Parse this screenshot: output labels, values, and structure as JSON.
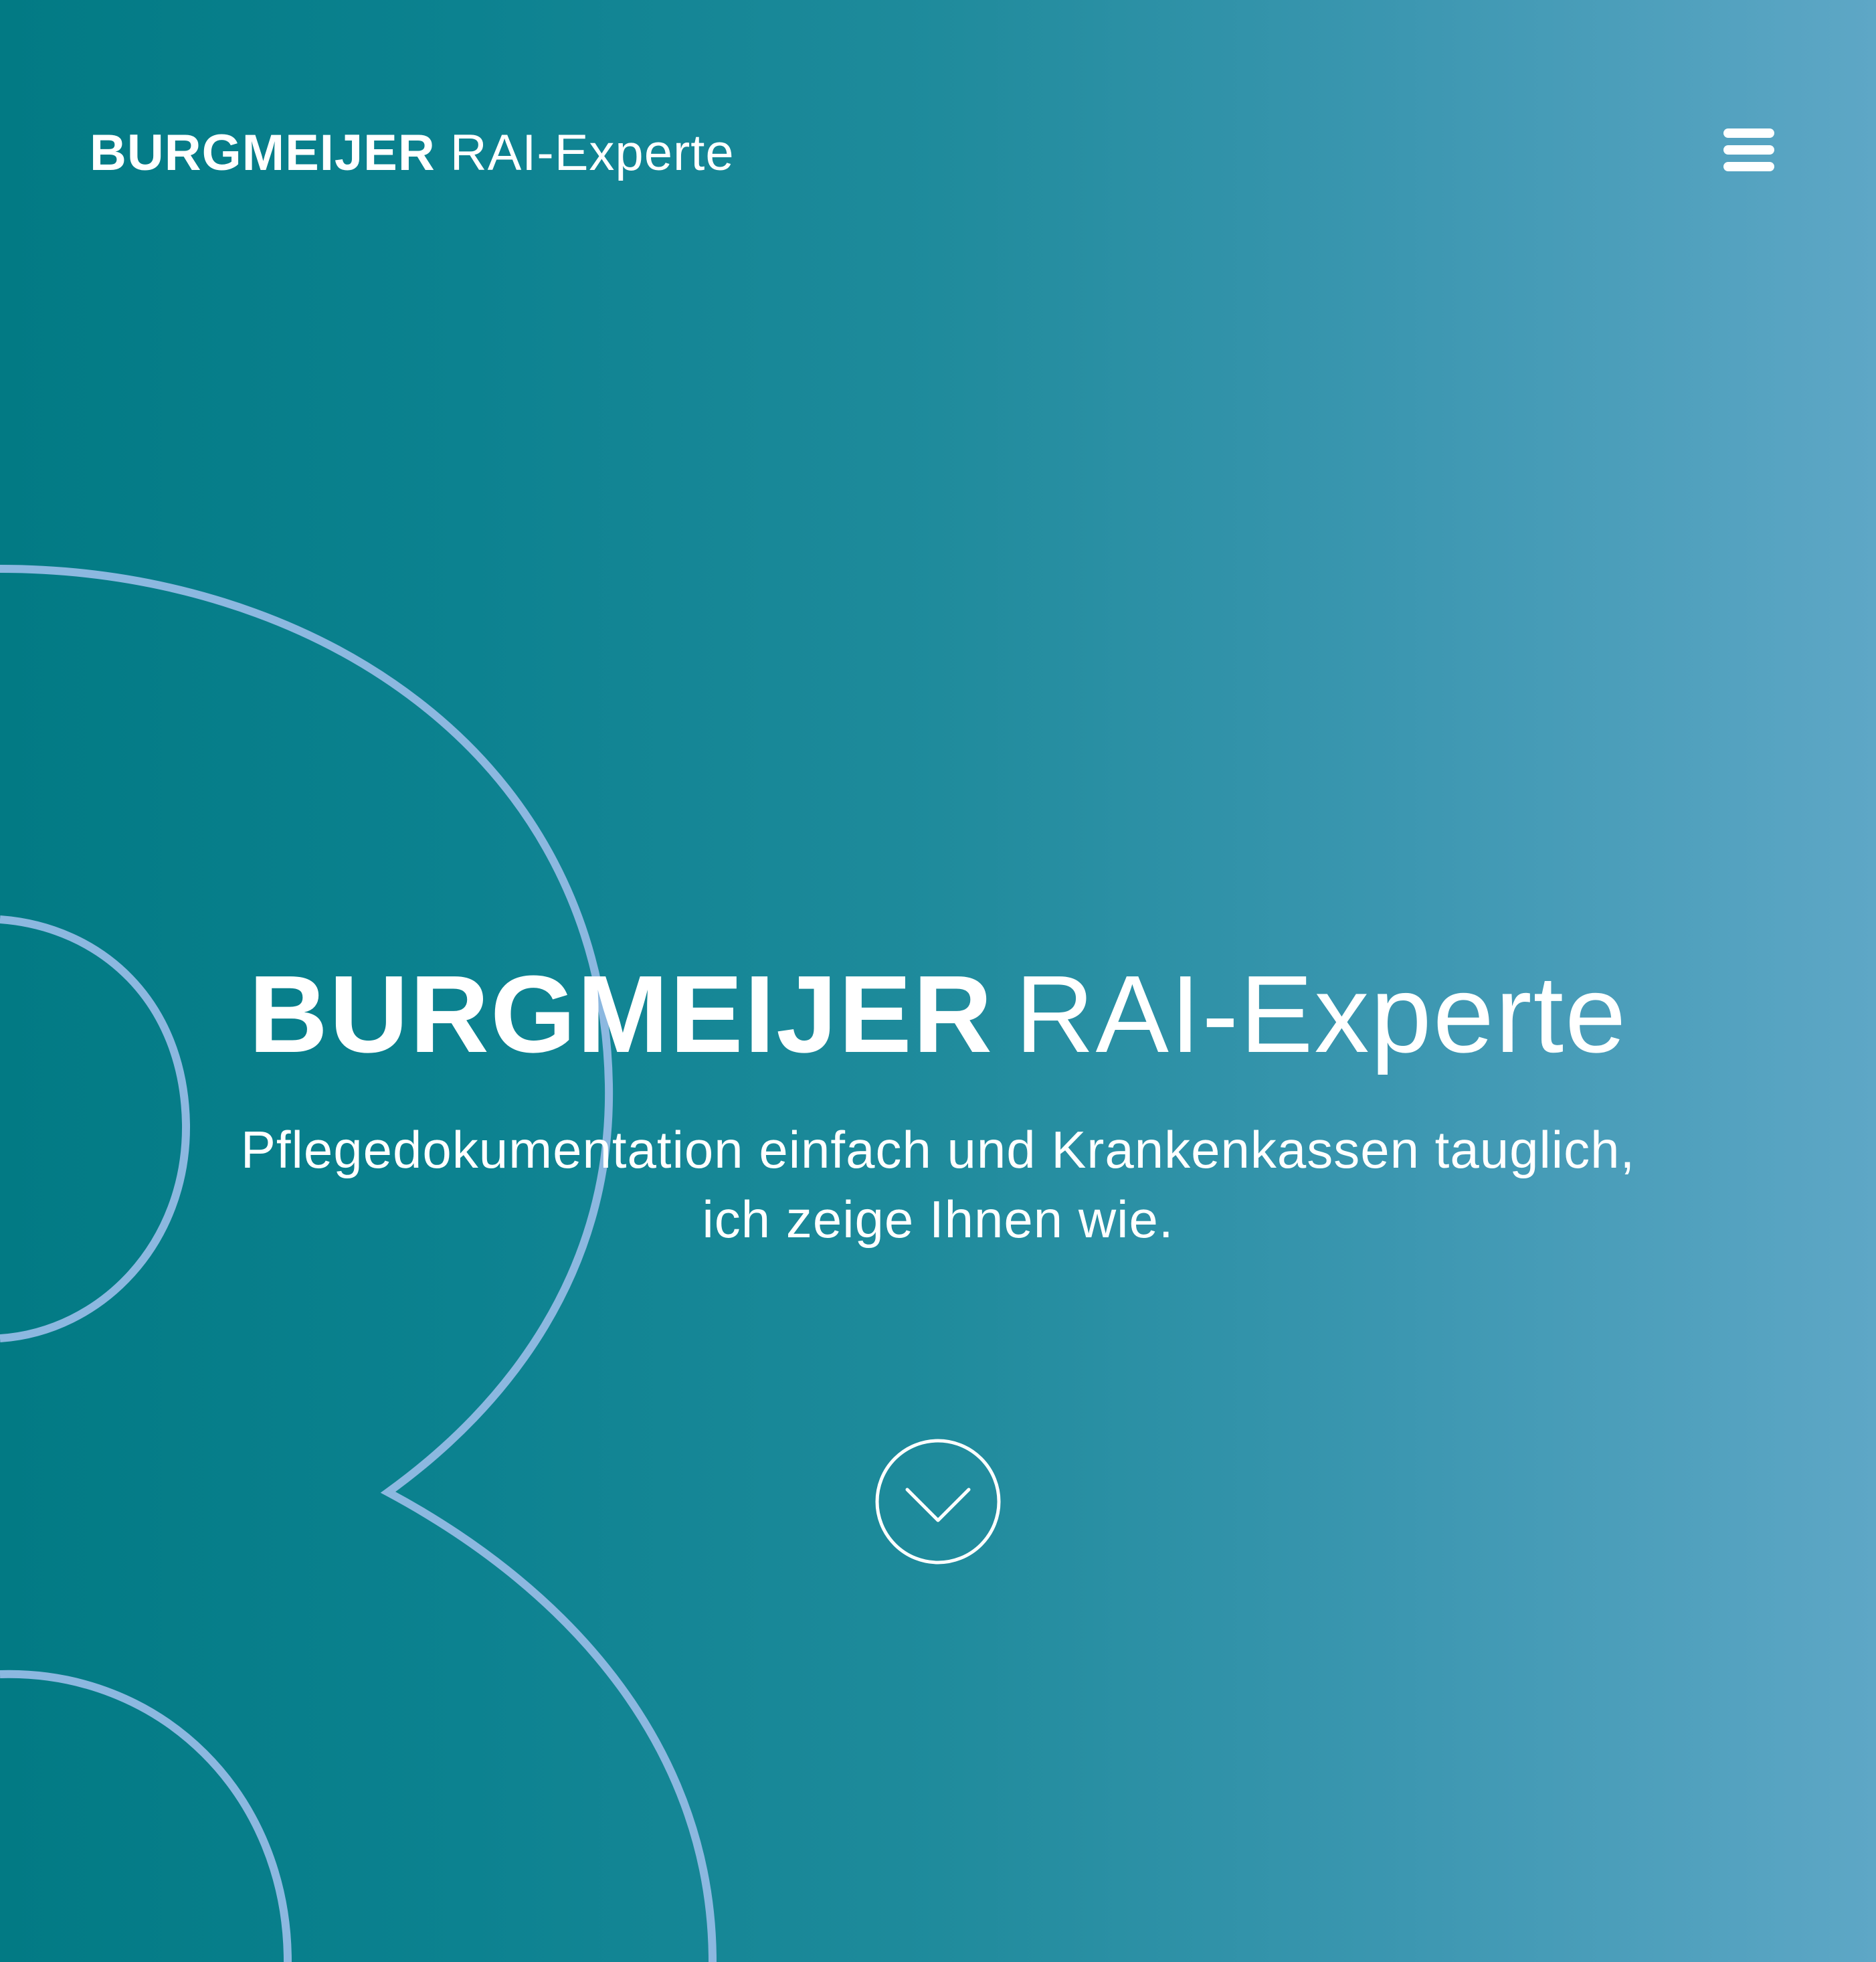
{
  "header": {
    "logo_bold": "BURGMEIJER",
    "logo_light": "RAI-Experte",
    "menu_icon": "hamburger-menu-icon"
  },
  "hero": {
    "title_bold": "BURGMEIJER",
    "title_light": "RAI-Experte",
    "subtitle_line1": "Pflegedokumentation einfach und Krankenkassen tauglich,",
    "subtitle_line2": "ich zeige Ihnen wie.",
    "scroll_icon": "chevron-down-circle-icon"
  },
  "colors": {
    "gradient_start": "#027a84",
    "gradient_end": "#5ea7c6",
    "outline_stroke": "#8cb8e0",
    "text": "#ffffff"
  }
}
